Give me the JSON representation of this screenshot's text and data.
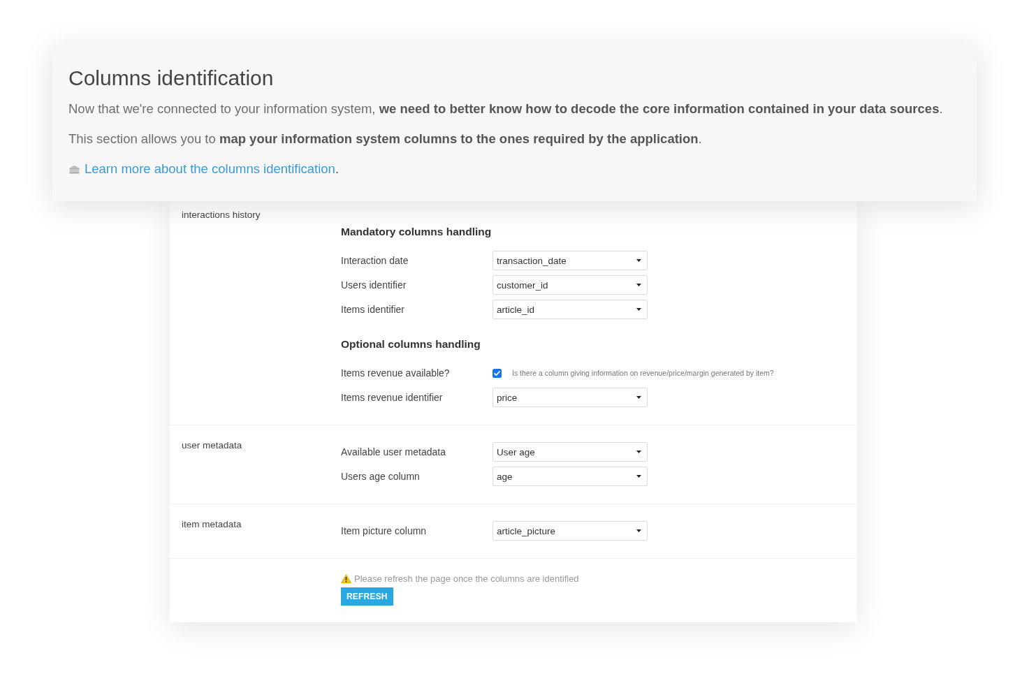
{
  "header": {
    "title": "Columns identification",
    "paragraphs": [
      "Now that we're connected to your information system, **we need to better know how to decode the core information contained in your data sources**.",
      "This section allows you to **map your information system columns to the ones required by the application**."
    ],
    "link": {
      "text": "Learn more about the columns identification",
      "suffix": "."
    }
  },
  "sections": [
    {
      "label": "interactions history",
      "groups": [
        {
          "heading": "Mandatory columns handling",
          "fields": [
            {
              "kind": "select",
              "label": "Interaction date",
              "value": "transaction_date"
            },
            {
              "kind": "select",
              "label": "Users identifier",
              "value": "customer_id"
            },
            {
              "kind": "select",
              "label": "Items identifier",
              "value": "article_id"
            }
          ]
        },
        {
          "heading": "Optional columns handling",
          "fields": [
            {
              "kind": "checkbox",
              "label": "Items revenue available?",
              "checked": true,
              "hint": "Is there a column giving information on revenue/price/margin generated by item?"
            },
            {
              "kind": "select",
              "label": "Items revenue identifier",
              "value": "price"
            }
          ]
        }
      ]
    },
    {
      "label": "user metadata",
      "groups": [
        {
          "fields": [
            {
              "kind": "select",
              "label": "Available user metadata",
              "value": "User age"
            },
            {
              "kind": "select",
              "label": "Users age column",
              "value": "age"
            }
          ]
        }
      ]
    },
    {
      "label": "item metadata",
      "groups": [
        {
          "fields": [
            {
              "kind": "select",
              "label": "Item picture column",
              "value": "article_picture"
            }
          ]
        }
      ]
    }
  ],
  "footer": {
    "warning": "Please refresh the page once the columns are identified",
    "button": "REFRESH"
  }
}
